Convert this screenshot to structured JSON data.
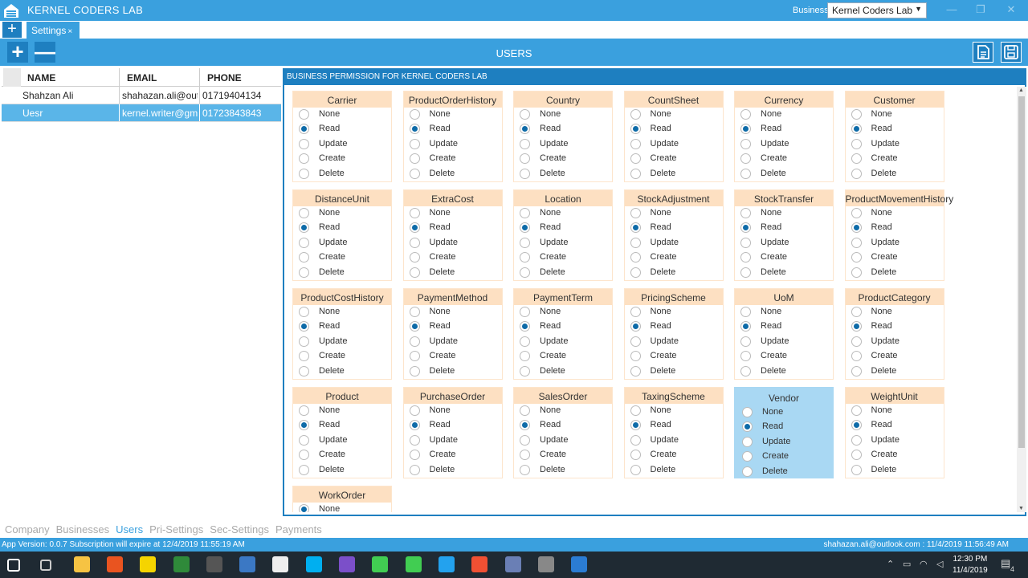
{
  "app": {
    "title": "KERNEL CODERS LAB",
    "business_label": "Business:",
    "business_value": "Kernel Coders Lab",
    "window_buttons": [
      "—",
      "❐",
      "✕"
    ]
  },
  "tabs": [
    {
      "label": "Settings",
      "close": "×"
    }
  ],
  "toolbar": {
    "title": "USERS",
    "add_label": "+",
    "remove_label": "—"
  },
  "users": {
    "columns": [
      "NAME",
      "EMAIL",
      "PHONE"
    ],
    "rows": [
      {
        "name": "Shahzan Ali",
        "email": "shahazan.ali@outlook.com",
        "phone": "01719404134",
        "selected": false
      },
      {
        "name": "Uesr",
        "email": "kernel.writer@gmail.com",
        "phone": "01723843843",
        "selected": true
      }
    ]
  },
  "permissions": {
    "header": "BUSINESS PERMISSION FOR KERNEL CODERS LAB",
    "options": [
      "None",
      "Read",
      "Update",
      "Create",
      "Delete"
    ],
    "entities": [
      {
        "name": "Carrier",
        "selected": "Read"
      },
      {
        "name": "ProductOrderHistory",
        "selected": "Read"
      },
      {
        "name": "Country",
        "selected": "Read"
      },
      {
        "name": "CountSheet",
        "selected": "Read"
      },
      {
        "name": "Currency",
        "selected": "Read"
      },
      {
        "name": "Customer",
        "selected": "Read"
      },
      {
        "name": "DistanceUnit",
        "selected": "Read"
      },
      {
        "name": "ExtraCost",
        "selected": "Read"
      },
      {
        "name": "Location",
        "selected": "Read"
      },
      {
        "name": "StockAdjustment",
        "selected": "Read"
      },
      {
        "name": "StockTransfer",
        "selected": "Read"
      },
      {
        "name": "ProductMovementHistory",
        "selected": "Read"
      },
      {
        "name": "ProductCostHistory",
        "selected": "Read"
      },
      {
        "name": "PaymentMethod",
        "selected": "Read"
      },
      {
        "name": "PaymentTerm",
        "selected": "Read"
      },
      {
        "name": "PricingScheme",
        "selected": "Read"
      },
      {
        "name": "UoM",
        "selected": "Read"
      },
      {
        "name": "ProductCategory",
        "selected": "Read"
      },
      {
        "name": "Product",
        "selected": "Read"
      },
      {
        "name": "PurchaseOrder",
        "selected": "Read"
      },
      {
        "name": "SalesOrder",
        "selected": "Read"
      },
      {
        "name": "TaxingScheme",
        "selected": "Read"
      },
      {
        "name": "Vendor",
        "selected": "Read",
        "highlighted": true
      },
      {
        "name": "WeightUnit",
        "selected": "Read"
      },
      {
        "name": "WorkOrder",
        "selected": "None"
      }
    ]
  },
  "bottom_tabs": [
    {
      "label": "Company",
      "active": false
    },
    {
      "label": "Businesses",
      "active": false
    },
    {
      "label": "Users",
      "active": true
    },
    {
      "label": "Pri-Settings",
      "active": false
    },
    {
      "label": "Sec-Settings",
      "active": false
    },
    {
      "label": "Payments",
      "active": false
    }
  ],
  "status": {
    "left": "App Version: 0.0.7   Subscription will expire at 12/4/2019 11:55:19 AM",
    "right": "shahazan.ali@outlook.com : 11/4/2019 11:56:49 AM"
  },
  "taskbar": {
    "time": "12:30 PM",
    "date": "11/4/2019",
    "notifications": "4",
    "icons": [
      "windows-start-icon",
      "task-view-icon",
      "file-explorer-icon",
      "ubuntu-icon",
      "norton-icon",
      "edge-icon",
      "calculator-icon",
      "paint-icon",
      "mail-icon",
      "skype-icon",
      "visual-studio-icon",
      "qt-icon",
      "qt-creator-icon",
      "vscode-icon",
      "git-icon",
      "vm-icon",
      "obs-icon",
      "app-icon"
    ],
    "colors": {
      "accent": "#3aa0de",
      "dark": "#1e7fc0",
      "card_header": "#fde0c2",
      "radio": "#0e6ba8"
    }
  }
}
